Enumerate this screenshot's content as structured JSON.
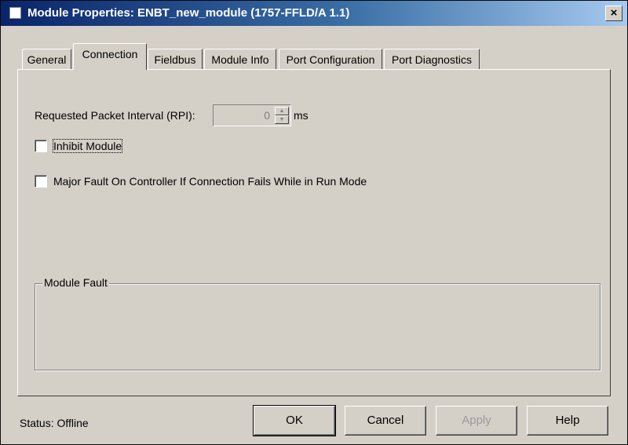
{
  "window": {
    "title": "Module Properties: ENBT_new_module (1757-FFLD/A 1.1)",
    "close_label": "×"
  },
  "tabs": [
    {
      "label": "General",
      "active": false
    },
    {
      "label": "Connection",
      "active": true
    },
    {
      "label": "Fieldbus",
      "active": false
    },
    {
      "label": "Module Info",
      "active": false
    },
    {
      "label": "Port Configuration",
      "active": false
    },
    {
      "label": "Port Diagnostics",
      "active": false
    }
  ],
  "connection": {
    "rpi_label": "Requested Packet Interval (RPI):",
    "rpi_value": "0",
    "rpi_unit": "ms",
    "inhibit_label": "Inhibit Module",
    "inhibit_checked": false,
    "major_fault_label": "Major Fault On Controller If Connection Fails While in Run Mode",
    "major_fault_checked": false,
    "module_fault_label": "Module Fault"
  },
  "status": {
    "label": "Status:",
    "value": "Offline"
  },
  "buttons": {
    "ok": "OK",
    "cancel": "Cancel",
    "apply": "Apply",
    "help": "Help"
  },
  "colors": {
    "titlebar_start": "#0a246a",
    "titlebar_end": "#a6caf0",
    "face": "#d4d0c8"
  }
}
